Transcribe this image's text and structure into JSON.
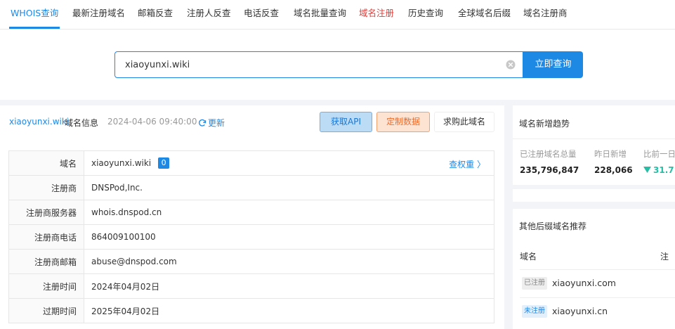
{
  "nav": {
    "tabs": [
      {
        "label": "WHOIS查询"
      },
      {
        "label": "最新注册域名"
      },
      {
        "label": "邮箱反查"
      },
      {
        "label": "注册人反查"
      },
      {
        "label": "电话反查"
      },
      {
        "label": "域名批量查询"
      },
      {
        "label": "域名注册"
      },
      {
        "label": "历史查询"
      },
      {
        "label": "全球域名后缀"
      },
      {
        "label": "域名注册商"
      }
    ]
  },
  "search": {
    "value": "xiaoyunxi.wiki",
    "button_label": "立即查询"
  },
  "info": {
    "domain": "xiaoyunxi.wiki",
    "title_suffix": "域名信息",
    "time": "2024-04-06 09:40:00",
    "refresh_label": "更新",
    "api_button": "获取API",
    "custom_button": "定制数据",
    "buy_button": "求购此域名",
    "rows": [
      {
        "label": "域名",
        "value": "xiaoyunxi.wiki"
      },
      {
        "label": "注册商",
        "value": "DNSPod,Inc."
      },
      {
        "label": "注册商服务器",
        "value": "whois.dnspod.cn"
      },
      {
        "label": "注册商电话",
        "value": "864009100100"
      },
      {
        "label": "注册商邮箱",
        "value": "abuse@dnspod.com"
      },
      {
        "label": "注册时间",
        "value": "2024年04月02日"
      },
      {
        "label": "过期时间",
        "value": "2025年04月02日"
      }
    ],
    "rank_badge": "0",
    "weight_link": "查权重 〉"
  },
  "trend": {
    "title": "域名新增趋势",
    "total_label": "已注册域名总量",
    "total_value": "235,796,847",
    "new_label": "昨日新增",
    "new_value": "228,066",
    "ratio_label": "比前一日",
    "ratio_value": "31.7"
  },
  "recommend": {
    "title": "其他后缀域名推荐",
    "col_domain": "域名",
    "col_status": "注",
    "rows": [
      {
        "tag": "已注册",
        "domain": "xiaoyunxi.com"
      },
      {
        "tag": "未注册",
        "domain": "xiaoyunxi.cn"
      }
    ]
  },
  "colors": {
    "accent": "#1e88e5",
    "red_tab": "#e53935",
    "orange": "#ef6c2c",
    "green": "#26bfa5"
  }
}
